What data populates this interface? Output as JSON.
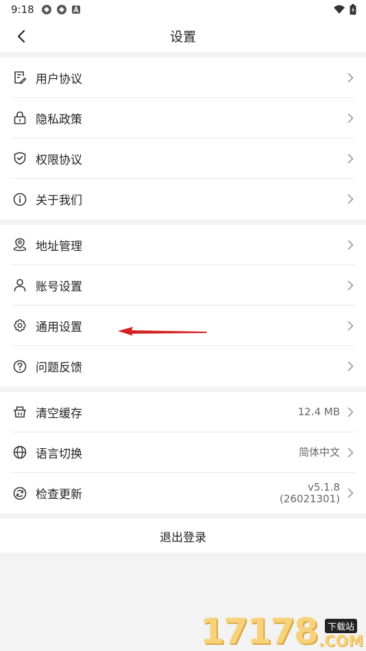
{
  "status_bar": {
    "time": "9:18"
  },
  "header": {
    "title": "设置"
  },
  "groups": [
    {
      "items": [
        {
          "label": "用户协议",
          "icon": "document-edit-icon"
        },
        {
          "label": "隐私政策",
          "icon": "lock-icon"
        },
        {
          "label": "权限协议",
          "icon": "shield-check-icon"
        },
        {
          "label": "关于我们",
          "icon": "info-icon"
        }
      ]
    },
    {
      "items": [
        {
          "label": "地址管理",
          "icon": "location-pin-icon"
        },
        {
          "label": "账号设置",
          "icon": "user-icon"
        },
        {
          "label": "通用设置",
          "icon": "gear-icon"
        },
        {
          "label": "问题反馈",
          "icon": "question-icon"
        }
      ]
    },
    {
      "items": [
        {
          "label": "清空缓存",
          "icon": "basket-icon",
          "value": "12.4 MB"
        },
        {
          "label": "语言切换",
          "icon": "globe-icon",
          "value": "简体中文"
        },
        {
          "label": "检查更新",
          "icon": "refresh-icon",
          "value_line1": "v5.1.8",
          "value_line2": "(26021301)"
        }
      ]
    }
  ],
  "logout_label": "退出登录",
  "watermark": {
    "number": "17178",
    "tag": "下载站",
    "suffix": ".COM"
  },
  "colors": {
    "annotation_arrow": "#d42020",
    "watermark": "#f7d27a"
  }
}
